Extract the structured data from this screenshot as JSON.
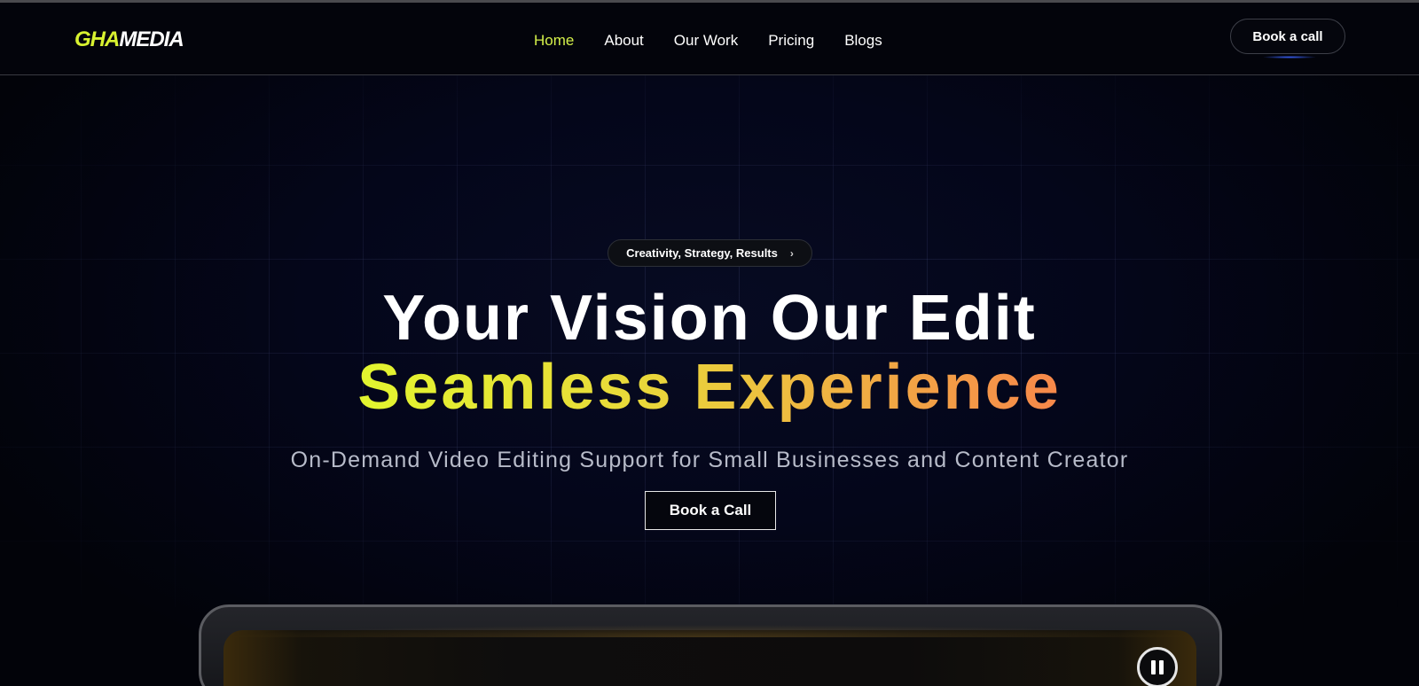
{
  "brand": {
    "logo_part1": "GHA",
    "logo_part2": "MEDIA",
    "accent_color": "#d8f230"
  },
  "nav": {
    "items": [
      {
        "label": "Home",
        "active": true
      },
      {
        "label": "About",
        "active": false
      },
      {
        "label": "Our Work",
        "active": false
      },
      {
        "label": "Pricing",
        "active": false
      },
      {
        "label": "Blogs",
        "active": false
      }
    ],
    "cta_label": "Book a call"
  },
  "hero": {
    "badge_text": "Creativity, Strategy, Results",
    "badge_icon": "chevron-right-icon",
    "headline_line1": "Your Vision Our Edit",
    "headline_line2": "Seamless Experience",
    "gradient_colors": [
      "#e2f52f",
      "#f7874a"
    ],
    "subtitle": "On-Demand Video Editing Support for Small Businesses and Content Creator",
    "cta_label": "Book a Call"
  },
  "video": {
    "control_icon": "pause-icon"
  }
}
